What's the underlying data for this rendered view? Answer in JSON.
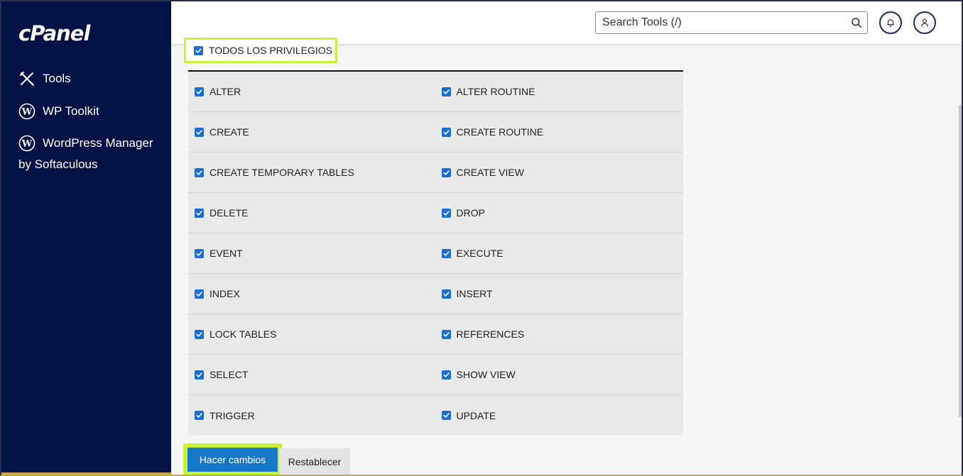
{
  "sidebar": {
    "logo": "cPanel",
    "items": [
      {
        "label": "Tools",
        "icon": "tools-icon"
      },
      {
        "label": "WP Toolkit",
        "icon": "wordpress-icon"
      },
      {
        "label_line1": "WordPress Manager",
        "label_line2": "by Softaculous",
        "icon": "wordpress-icon"
      }
    ]
  },
  "header": {
    "search_placeholder": "Search Tools (/)",
    "icons": [
      "search-icon",
      "bell-icon",
      "user-icon"
    ]
  },
  "all_privileges": {
    "label": "TODOS LOS PRIVILEGIOS",
    "checked": true
  },
  "privileges": [
    [
      "ALTER",
      "ALTER ROUTINE"
    ],
    [
      "CREATE",
      "CREATE ROUTINE"
    ],
    [
      "CREATE TEMPORARY TABLES",
      "CREATE VIEW"
    ],
    [
      "DELETE",
      "DROP"
    ],
    [
      "EVENT",
      "EXECUTE"
    ],
    [
      "INDEX",
      "INSERT"
    ],
    [
      "LOCK TABLES",
      "REFERENCES"
    ],
    [
      "SELECT",
      "SHOW VIEW"
    ],
    [
      "TRIGGER",
      "UPDATE"
    ]
  ],
  "buttons": {
    "submit": "Hacer cambios",
    "reset": "Restablecer"
  },
  "colors": {
    "sidebar_bg": "#021244",
    "highlight": "#c9f23a",
    "checkbox": "#1a6fd1",
    "primary_button": "#1778c9"
  }
}
